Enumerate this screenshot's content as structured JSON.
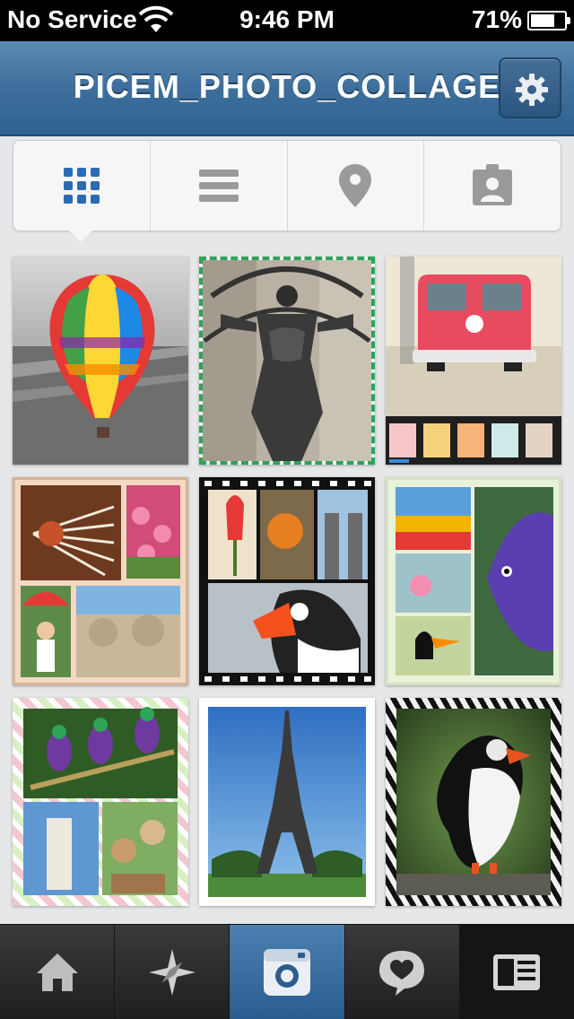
{
  "status_bar": {
    "carrier": "No Service",
    "time": "9:46 PM",
    "battery_percent": "71%",
    "battery_level": 0.71
  },
  "navbar": {
    "title": "PICEM_PHOTO_COLLAGE",
    "settings_icon": "gear-icon"
  },
  "view_tabs": [
    {
      "icon": "grid-icon",
      "selected": true
    },
    {
      "icon": "list-icon",
      "selected": false
    },
    {
      "icon": "location-pin-icon",
      "selected": false
    },
    {
      "icon": "tagged-person-icon",
      "selected": false
    }
  ],
  "tab_bar": [
    {
      "icon": "home-icon",
      "selected": false
    },
    {
      "icon": "explore-star-icon",
      "selected": false
    },
    {
      "icon": "camera-icon",
      "selected": true
    },
    {
      "icon": "activity-heart-icon",
      "selected": false
    },
    {
      "icon": "profile-card-icon",
      "selected": false
    }
  ],
  "colors": {
    "accent": "#3e6f9c",
    "active_tab": "#2f6190",
    "grid_icon_blue": "#2a6bb3"
  }
}
